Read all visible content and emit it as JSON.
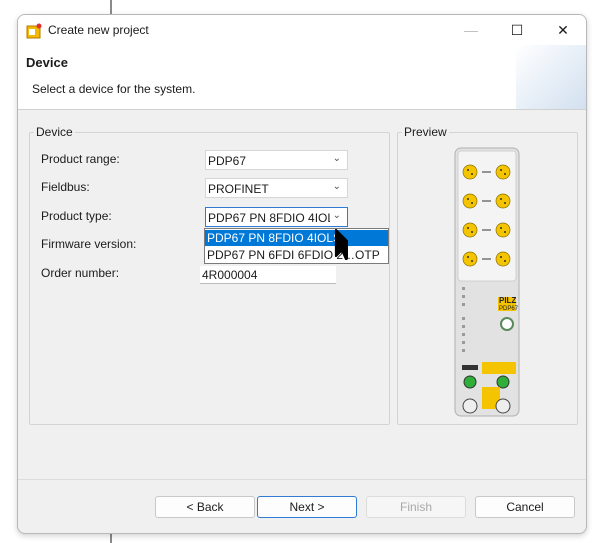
{
  "window": {
    "title": "Create new project",
    "minimize_glyph": "—",
    "maximize_glyph": "☐",
    "close_glyph": "✕",
    "app_icon": "project-wizard-icon"
  },
  "header": {
    "title": "Device",
    "subtitle": "Select a device for the system."
  },
  "device_group": {
    "label": "Device",
    "product_range": {
      "label": "Product range:",
      "value": "PDP67"
    },
    "fieldbus": {
      "label": "Fieldbus:",
      "value": "PROFINET"
    },
    "product_type": {
      "label": "Product type:",
      "value": "PDP67 PN 8FDIO 4IOL!",
      "options": [
        "PDP67 PN 8FDIO 4IOLS",
        "PDP67 PN 6FDI 6FDIO 2…OTP"
      ],
      "selected_index": 0
    },
    "firmware_version": {
      "label": "Firmware version:"
    },
    "order_number": {
      "label": "Order number:",
      "value": "4R000004"
    }
  },
  "preview_group": {
    "label": "Preview",
    "device_brand": "PILZ",
    "device_model": "PDP67"
  },
  "buttons": {
    "back": "< Back",
    "next": "Next >",
    "finish": "Finish",
    "cancel": "Cancel"
  },
  "colors": {
    "accent": "#0078d7",
    "dialog_bg": "#f0f0f0",
    "device_yellow": "#f5c400"
  }
}
